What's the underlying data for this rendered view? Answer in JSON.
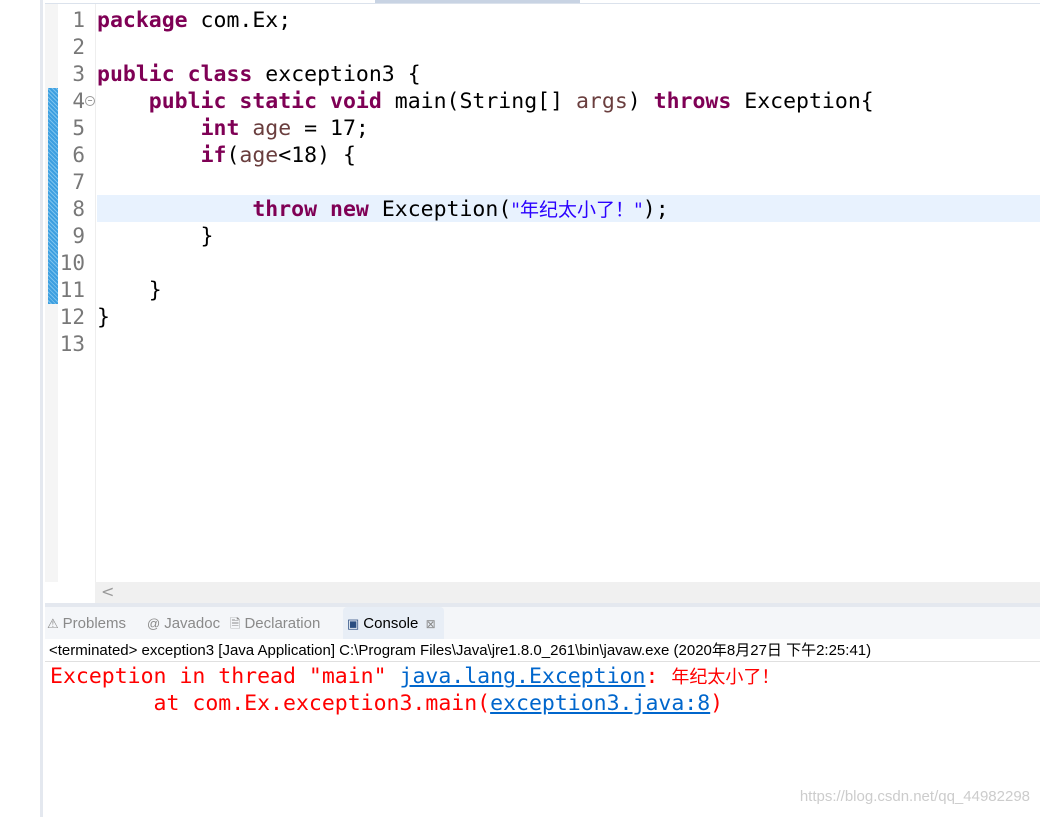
{
  "editor": {
    "line_numbers": [
      "1",
      "2",
      "3",
      "4",
      "5",
      "6",
      "7",
      "8",
      "9",
      "10",
      "11",
      "12",
      "13"
    ],
    "lines": [
      [
        {
          "t": "package",
          "c": "kw"
        },
        {
          "t": " com.Ex;"
        }
      ],
      [],
      [
        {
          "t": "public",
          "c": "kw"
        },
        {
          "t": " "
        },
        {
          "t": "class",
          "c": "kw"
        },
        {
          "t": " exception3 {"
        }
      ],
      [
        {
          "t": "    "
        },
        {
          "t": "public",
          "c": "kw"
        },
        {
          "t": " "
        },
        {
          "t": "static",
          "c": "kw"
        },
        {
          "t": " "
        },
        {
          "t": "void",
          "c": "kw"
        },
        {
          "t": " main(String[] "
        },
        {
          "t": "args",
          "c": "var"
        },
        {
          "t": ") "
        },
        {
          "t": "throws",
          "c": "kw"
        },
        {
          "t": " Exception{"
        }
      ],
      [
        {
          "t": "        "
        },
        {
          "t": "int",
          "c": "kw"
        },
        {
          "t": " "
        },
        {
          "t": "age",
          "c": "var"
        },
        {
          "t": " = 17;"
        }
      ],
      [
        {
          "t": "        "
        },
        {
          "t": "if",
          "c": "kw"
        },
        {
          "t": "("
        },
        {
          "t": "age",
          "c": "var"
        },
        {
          "t": "<18) {"
        }
      ],
      [],
      [
        {
          "t": "            "
        },
        {
          "t": "throw",
          "c": "kw"
        },
        {
          "t": " "
        },
        {
          "t": "new",
          "c": "kw"
        },
        {
          "t": " Exception("
        },
        {
          "t": "\"年纪太小了！\"",
          "c": "str"
        },
        {
          "t": ");"
        }
      ],
      [
        {
          "t": "        }"
        }
      ],
      [],
      [
        {
          "t": "    }"
        }
      ],
      [
        {
          "t": "}"
        }
      ],
      []
    ],
    "current_line": 8
  },
  "tabs": [
    {
      "label": "Problems",
      "icon": "problems-icon",
      "glyph": "⚠"
    },
    {
      "label": "Javadoc",
      "icon": "at-icon",
      "glyph": "@"
    },
    {
      "label": "Declaration",
      "icon": "declaration-icon",
      "glyph": "🗎"
    },
    {
      "label": "Console",
      "icon": "console-icon",
      "glyph": "▣",
      "active": true
    }
  ],
  "console": {
    "header": "<terminated> exception3 [Java Application] C:\\Program Files\\Java\\jre1.8.0_261\\bin\\javaw.exe (2020年8月27日 下午2:25:41)",
    "line1_prefix": "Exception in thread \"main\" ",
    "line1_link": "java.lang.Exception",
    "line1_sep": ": ",
    "line1_msg": "年纪太小了！",
    "line2_prefix": "        at com.Ex.exception3.main(",
    "line2_link": "exception3.java:8",
    "line2_suffix": ")"
  },
  "watermark": "https://blog.csdn.net/qq_44982298"
}
